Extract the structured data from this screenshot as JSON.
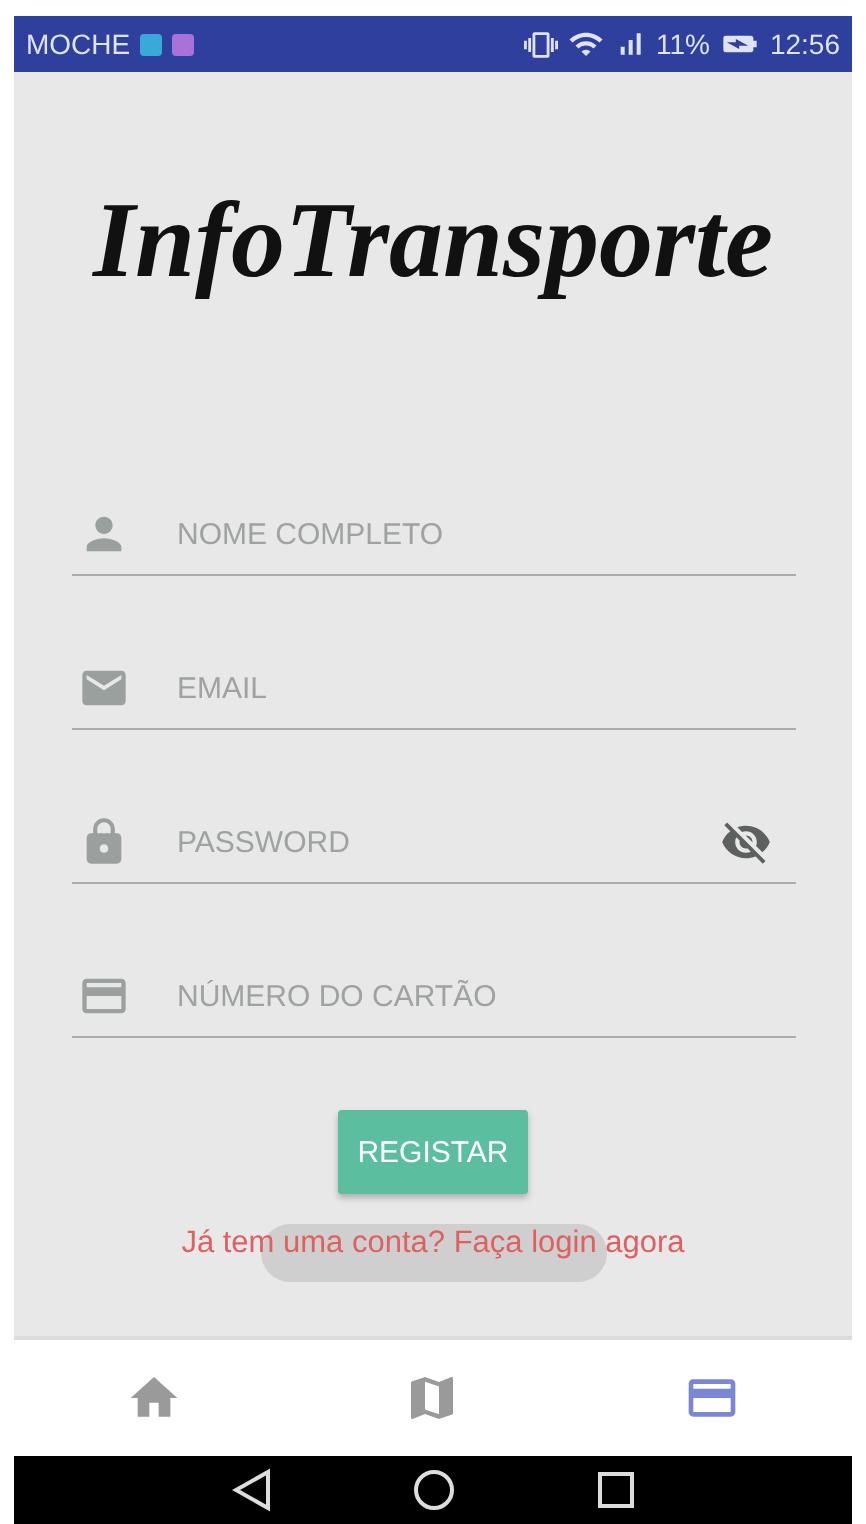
{
  "status_bar": {
    "carrier": "MOCHE",
    "battery": "11%",
    "time": "12:56"
  },
  "logo": "InfoTransporte",
  "fields": [
    {
      "kind": "person",
      "placeholder": "NOME COMPLETO"
    },
    {
      "kind": "email",
      "placeholder": "EMAIL"
    },
    {
      "kind": "password",
      "placeholder": "PASSWORD",
      "visible": false
    },
    {
      "kind": "card",
      "placeholder": "NÚMERO DO CARTÃO"
    }
  ],
  "register_button": "REGISTAR",
  "login_link": "Já tem uma conta? Faça login agora",
  "toast_visible": true,
  "bottom_nav": [
    {
      "kind": "home",
      "selected": false
    },
    {
      "kind": "map",
      "selected": false
    },
    {
      "kind": "card",
      "selected": true
    }
  ]
}
